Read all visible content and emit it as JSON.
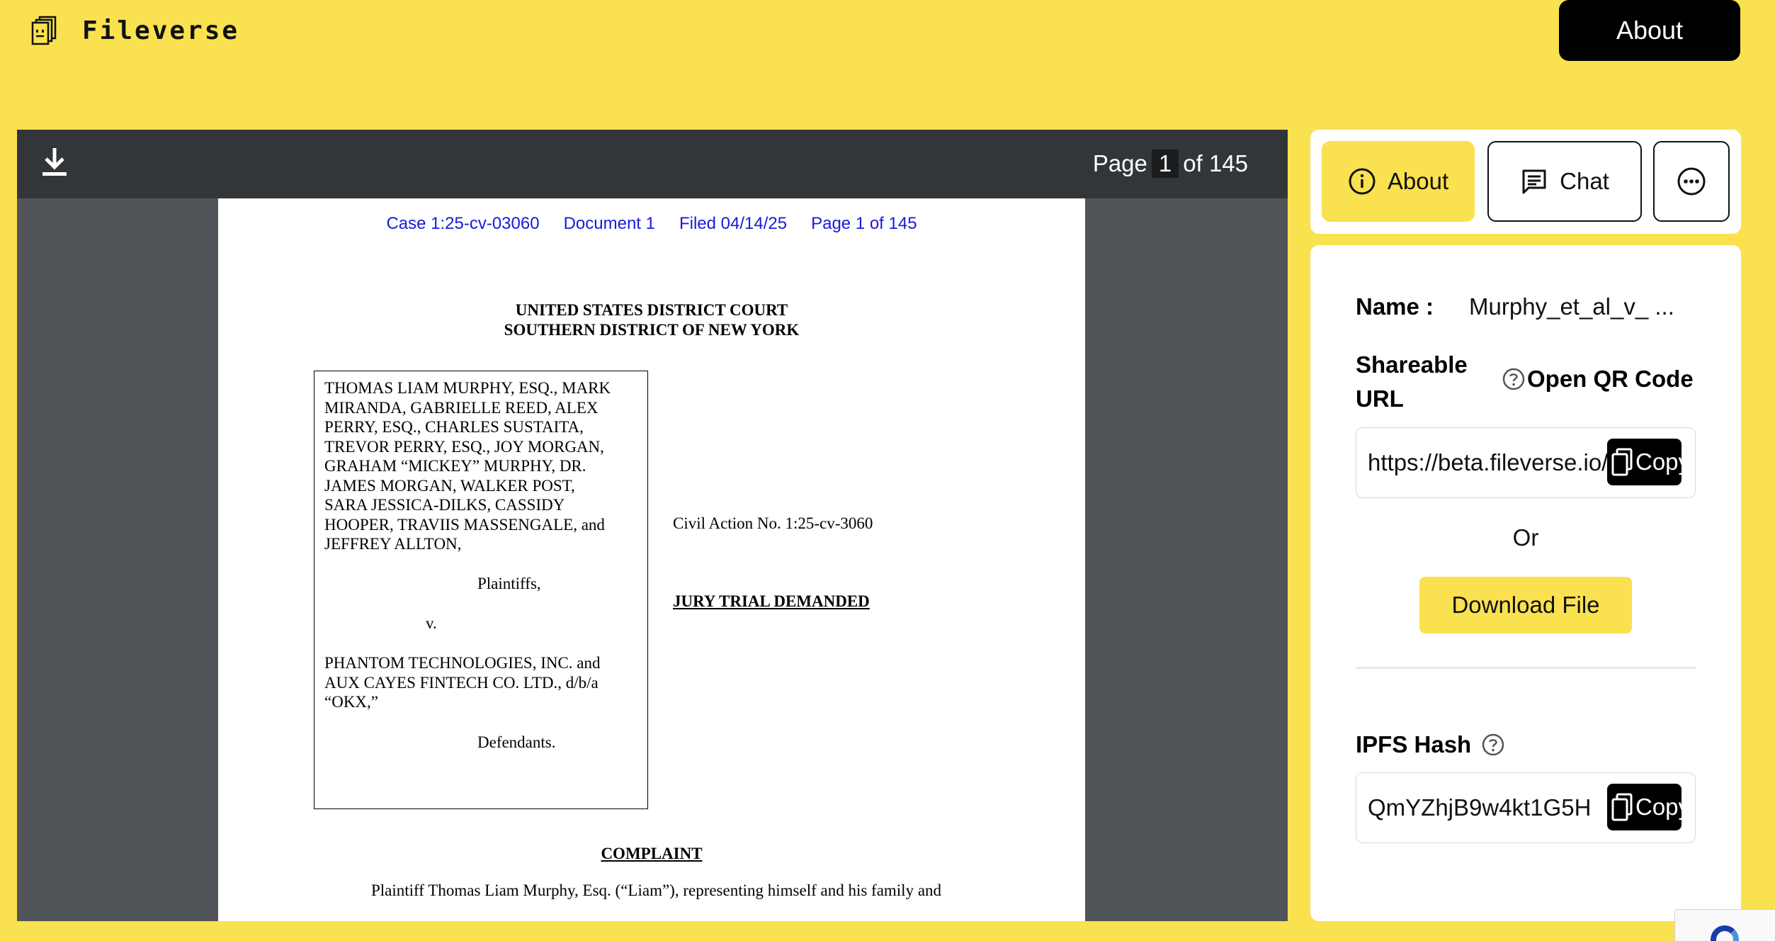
{
  "app": {
    "name": "Fileverse",
    "top_about_label": "About"
  },
  "viewer": {
    "page_label": "Page",
    "current_page": "1",
    "of_label": "of 145"
  },
  "document": {
    "header": {
      "case": "Case 1:25-cv-03060",
      "doc": "Document 1",
      "filed": "Filed 04/14/25",
      "page": "Page 1 of 145"
    },
    "court_line1": "UNITED STATES DISTRICT COURT",
    "court_line2": "SOUTHERN DISTRICT OF NEW YORK",
    "plaintiff_lines": [
      "THOMAS LIAM MURPHY, ESQ., MARK",
      "MIRANDA, GABRIELLE REED, ALEX",
      "PERRY, ESQ., CHARLES SUSTAITA,",
      "TREVOR PERRY, ESQ., JOY MORGAN,",
      "GRAHAM “MICKEY” MURPHY, DR.",
      "JAMES MORGAN, WALKER POST,",
      "SARA JESSICA-DILKS, CASSIDY",
      "HOOPER, TRAVIIS MASSENGALE, and",
      "JEFFREY ALLTON,"
    ],
    "plaintiffs_label": "Plaintiffs,",
    "versus": "v.",
    "defendant_lines": [
      "PHANTOM TECHNOLOGIES, INC. and",
      "AUX CAYES FINTECH CO. LTD., d/b/a",
      "“OKX,”"
    ],
    "defendants_label": "Defendants.",
    "civil_action": "Civil Action No. 1:25-cv-3060",
    "jury": "JURY TRIAL DEMANDED",
    "complaint_title": "COMPLAINT",
    "body_line": "Plaintiff Thomas Liam Murphy, Esq. (“Liam”), representing himself and his family and"
  },
  "panel": {
    "tabs": [
      {
        "label": "About",
        "icon": "info-icon"
      },
      {
        "label": "Chat",
        "icon": "chat-icon"
      },
      {
        "label": "",
        "icon": "more-icon"
      }
    ],
    "name_label": "Name :",
    "name_value": "Murphy_et_al_v_ ...",
    "shareable_label": "Shareable URL",
    "qr_label": "Open QR Code",
    "url_value": "https://beta.fileverse.io/",
    "copy_label": "Copy",
    "or_label": "Or",
    "download_label": "Download File",
    "ipfs_label": "IPFS Hash",
    "ipfs_value": "QmYZhjB9w4kt1G5H"
  },
  "colors": {
    "brand_yellow": "#fae14f",
    "toolbar_dark": "#323639",
    "viewer_bg": "#515559",
    "link_blue": "#1a1ad8"
  }
}
